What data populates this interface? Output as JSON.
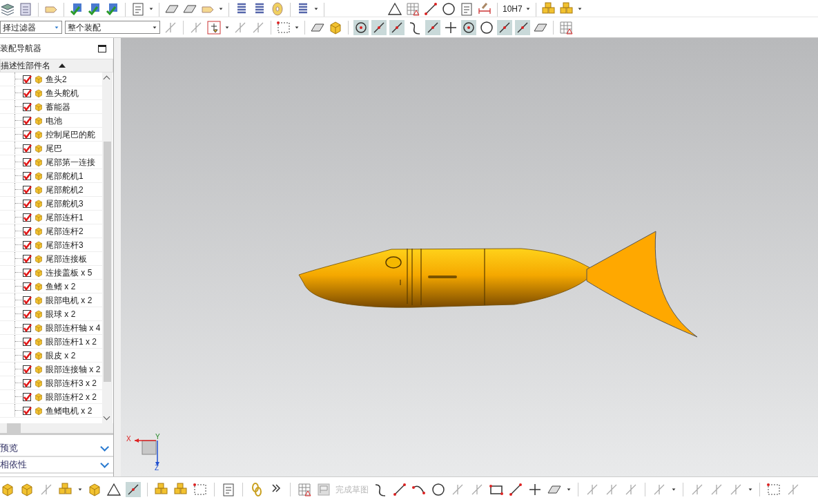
{
  "toolbar": {
    "filter": "择过滤器",
    "scope": "整个装配",
    "fit_label": "10H7"
  },
  "navigator": {
    "title": "装配导航器",
    "column": "描述性部件名",
    "parts": [
      {
        "name": "鱼头2",
        "checked": true
      },
      {
        "name": "鱼头舵机",
        "checked": true
      },
      {
        "name": "蓄能器",
        "checked": true
      },
      {
        "name": "电池",
        "checked": true
      },
      {
        "name": "控制尾巴的舵",
        "checked": true
      },
      {
        "name": "尾巴",
        "checked": true
      },
      {
        "name": "尾部第一连接",
        "checked": true
      },
      {
        "name": "尾部舵机1",
        "checked": true
      },
      {
        "name": "尾部舵机2",
        "checked": true
      },
      {
        "name": "尾部舵机3",
        "checked": true
      },
      {
        "name": "尾部连杆1",
        "checked": true
      },
      {
        "name": "尾部连杆2",
        "checked": true
      },
      {
        "name": "尾部连杆3",
        "checked": true
      },
      {
        "name": "尾部连接板",
        "checked": true
      },
      {
        "name": "连接盖板 x 5",
        "checked": true
      },
      {
        "name": "鱼鳍 x 2",
        "checked": true
      },
      {
        "name": "眼部电机 x 2",
        "checked": true
      },
      {
        "name": "眼球 x 2",
        "checked": true
      },
      {
        "name": "眼部连杆轴 x 4",
        "checked": true
      },
      {
        "name": "眼部连杆1 x 2",
        "checked": true
      },
      {
        "name": "眼皮 x 2",
        "checked": true
      },
      {
        "name": "眼部连接轴 x 2",
        "checked": true
      },
      {
        "name": "眼部连杆3 x 2",
        "checked": true
      },
      {
        "name": "眼部连杆2 x 2",
        "checked": true
      },
      {
        "name": "鱼鳍电机 x 2",
        "checked": true
      }
    ]
  },
  "panels": [
    {
      "title": "预览",
      "expanded": false
    },
    {
      "title": "相依性",
      "expanded": false
    }
  ],
  "sketch_toolbar": {
    "finish_sketch": "完成草图"
  },
  "viewport": {
    "axes": [
      "X",
      "Y",
      "Z"
    ]
  }
}
